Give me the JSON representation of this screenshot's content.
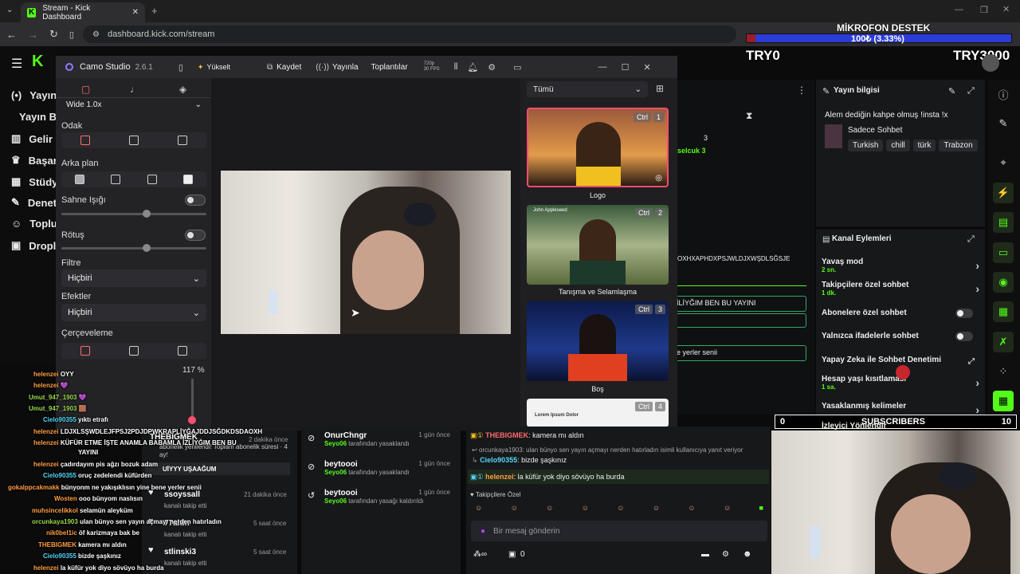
{
  "browser": {
    "tab_title": "Stream - Kick Dashboard",
    "url": "dashboard.kick.com/stream"
  },
  "overlay": {
    "mic_title": "MİKROFON DESTEK",
    "mic_progress_text": "100₺ (3.33%)",
    "mic_progress_fraction": 0.0333,
    "try_left": "TRY0",
    "try_right": "TRY3000",
    "subs_left": "0",
    "subs_label": "SUBSCRIBERS",
    "subs_right": "10"
  },
  "kick_nav": [
    {
      "label": "Yayın",
      "icon": "stream-icon"
    },
    {
      "label": "Yayın Ba",
      "icon": ""
    },
    {
      "label": "Gelir",
      "icon": "chart-icon"
    },
    {
      "label": "Başarıl",
      "icon": "trophy-icon"
    },
    {
      "label": "Stüdyo",
      "icon": "film-icon"
    },
    {
      "label": "Denetl",
      "icon": "wrench-icon"
    },
    {
      "label": "Toplul",
      "icon": "people-icon"
    },
    {
      "label": "Dropla",
      "icon": "gift-icon"
    }
  ],
  "camo": {
    "title": "Camo Studio",
    "version": "2.6.1",
    "upgrade": "Yükselt",
    "record": "Kaydet",
    "broadcast": "Yayınla",
    "meetings": "Toplantılar",
    "res_top": "720p",
    "res_bottom": "30 FPS",
    "lens": "Wide 1.0x",
    "focus_label": "Odak",
    "background_label": "Arka plan",
    "studio_light_label": "Sahne Işığı",
    "retouch_label": "Rötuş",
    "filter_label": "Filtre",
    "filter_value": "Hiçbiri",
    "effects_label": "Efektler",
    "effects_value": "Hiçbiri",
    "framing_label": "Çerçeveleme",
    "zoom_value": "117 %",
    "scene_filter": "Tümü",
    "scenes": [
      {
        "caption": "Logo",
        "ctrl": "Ctrl",
        "num": "1"
      },
      {
        "caption": "Tanışma ve Selamlaşma",
        "ctrl": "Ctrl",
        "num": "2",
        "overlay_name": "John Appleseed"
      },
      {
        "caption": "Boş",
        "ctrl": "Ctrl",
        "num": "3"
      },
      {
        "caption": "",
        "ctrl": "Ctrl",
        "num": "4",
        "overlay_name": "Lorem Ipsum Dolor"
      }
    ]
  },
  "kick_mid": {
    "line1": "3",
    "line2": "selcuk 3",
    "line3": "OXHXAPHDXPSJWLDJXWŞDLSĞSJE",
    "line4": "İLİYĞIM BEN BU YAYINI",
    "line5": "e yerler senii"
  },
  "yayin_bilgisi": {
    "header": "Yayın bilgisi",
    "title": "Alem dediğin kahpe olmuş !insta !x",
    "category": "Sadece Sohbet",
    "tags": [
      "Turkish",
      "chill",
      "türk",
      "Trabzon"
    ]
  },
  "kanal_eylemleri": {
    "header": "Kanal Eylemleri",
    "items": [
      {
        "label": "Yavaş mod",
        "sub": "2 sn.",
        "kind": "chevron"
      },
      {
        "label": "Takipçilere özel sohbet",
        "sub": "1 dk.",
        "kind": "chevron"
      },
      {
        "label": "Abonelere özel sohbet",
        "sub": "",
        "kind": "toggle"
      },
      {
        "label": "Yalnızca ifadelerle sohbet",
        "sub": "",
        "kind": "toggle"
      },
      {
        "label": "Yapay Zeka ile Sohbet Denetimi",
        "sub": "",
        "kind": "external"
      },
      {
        "label": "Hesap yaşı kısıtlaması",
        "sub": "1 sa.",
        "kind": "chevron"
      },
      {
        "label": "Yasaklanmış kelimeler",
        "sub": "",
        "kind": "chevron"
      },
      {
        "label": "İzleyici Yönlendir",
        "sub": "",
        "kind": "none"
      }
    ]
  },
  "overlay_chat": [
    {
      "user": "helenzei",
      "msg": "OYY",
      "color": "o"
    },
    {
      "user": "helenzei",
      "msg": "💜",
      "color": "o"
    },
    {
      "user": "Umut_947_1903",
      "msg": "💜",
      "color": "g"
    },
    {
      "user": "Umut_947_1903",
      "msg": "🟫",
      "color": "g"
    },
    {
      "user": "Cielo90355",
      "msg": "yıktı etrafı",
      "color": "u"
    },
    {
      "user": "helenzei",
      "msg": "LDJXLSŞWDLEJFPSJ2PDJDPWKRAPLİYĞAJDDJSĞDKDSDAOXH",
      "color": "o"
    },
    {
      "user": "helenzei",
      "msg": "KÜFÜR ETME İŞTE ANAMLA BABAMLA İZLİYĞIM BEN BU",
      "color": "o"
    },
    {
      "user": "",
      "msg": "YAYINI",
      "color": "o"
    },
    {
      "user": "helenzei",
      "msg": "çadırdayım pis ağzı bozuk adam",
      "color": "o"
    },
    {
      "user": "Cielo90355",
      "msg": "oruç zedelendi küfürden",
      "color": "u"
    },
    {
      "user": "gokalppcakmakk",
      "msg": "bünyonm ne yakışıklısın yine bene yerler senii",
      "color": "o"
    },
    {
      "user": "Wosten",
      "msg": "ooo bünyom naslısın",
      "color": "o"
    },
    {
      "user": "muhsincelikkol",
      "msg": "selamün aleyküm",
      "color": "o"
    },
    {
      "user": "orcunkaya1903",
      "msg": "ulan bünyo sen yayın açmayı nerden hatırladın",
      "color": "g"
    },
    {
      "user": "nik0bel1ic",
      "msg": "öf karizmaya bak be",
      "color": "o"
    },
    {
      "user": "THEBIGMEK",
      "msg": "kamera mı aldın",
      "color": "o"
    },
    {
      "user": "Cielo90355",
      "msg": "bizde şaşkınız",
      "color": "u"
    },
    {
      "user": "helenzei",
      "msg": "la küfür yok diyo sövüyo ha burda",
      "color": "o"
    }
  ],
  "notifications": [
    {
      "name": "THEBIGMEK",
      "sub": "abonelik yenilendi! Toplam abonelik süresi · 4 ay!",
      "time": "2 dakika önce"
    },
    {
      "name": "UİYYY UŞAAĞUM",
      "sub": "",
      "time": ""
    },
    {
      "name": "ssoyssall",
      "sub": "kanalı takip etti",
      "time": "21 dakika önce"
    },
    {
      "name": "77aldn",
      "sub": "kanalı takip etti",
      "time": "5 saat önce"
    },
    {
      "name": "stlinski3",
      "sub": "kanalı takip etti",
      "time": "5 saat önce"
    }
  ],
  "mod_log": [
    {
      "name": "OnurChngr",
      "actor": "Seyo06",
      "action": "tarafından yasaklandı",
      "time": "1 gün önce"
    },
    {
      "name": "beytoooi",
      "actor": "Seyo06",
      "action": "tarafından yasaklandı",
      "time": "1 gün önce"
    },
    {
      "name": "beytoooi",
      "actor": "Seyo06",
      "action": "tarafından yasağı kaldırıldı",
      "time": "1 gün önce"
    }
  ],
  "kick_chat": {
    "lines": [
      {
        "user": "THEBIGMEK",
        "msg": ": kamera mı aldın"
      },
      {
        "reply": "orcunkaya1903: ulan bünyo sen yayın açmayı nerden hatırladın isimli kullanıcıya yanıt veriyor"
      },
      {
        "user": "Cielo90355",
        "msg": ": bizde şaşkınız"
      },
      {
        "user": "helenzei",
        "msg": ": la küfür yok diyo sövüyo ha burda"
      }
    ],
    "follower_label": "Takipçilere Özel",
    "placeholder": "Bir mesaj gönderin",
    "bottom_count": "0"
  },
  "colors": {
    "kick_green": "#53fc18",
    "mic_bar": "#2c3cd6",
    "camo_accent": "#ff4d6d"
  }
}
